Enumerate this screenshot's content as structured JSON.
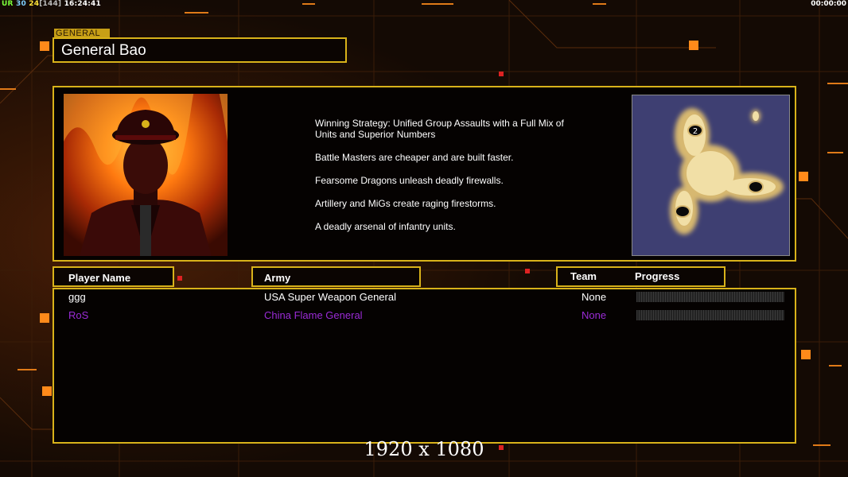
{
  "hud": {
    "label_a": "UR",
    "fps_a": "30",
    "fps_b": "24",
    "bracket": "[144]",
    "clock": "16:24:41",
    "timer": "00:00:00"
  },
  "general": {
    "tag": "GENERAL",
    "name": "General Bao"
  },
  "strategy": [
    "Winning Strategy: Unified Group Assaults with a Full Mix of Units and Superior Numbers",
    "Battle Masters are cheaper and are built faster.",
    "Fearsome Dragons unleash deadly firewalls.",
    "Artillery and MiGs create raging firestorms.",
    "A deadly arsenal of infantry units."
  ],
  "minimap": {
    "start_marker": "2"
  },
  "columns": {
    "player_name": "Player Name",
    "army": "Army",
    "team": "Team",
    "progress": "Progress"
  },
  "players": [
    {
      "name": "ggg",
      "army": "USA Super Weapon General",
      "team": "None",
      "color": "#ffffff",
      "progress": 0
    },
    {
      "name": "RoS",
      "army": "China Flame General",
      "team": "None",
      "color": "#9a2bd6",
      "progress": 0
    }
  ],
  "resolution": "1920 x 1080",
  "colors": {
    "frame": "#d8b21a",
    "accent_orange": "#ff8a1a",
    "hud_green": "#7cff3a",
    "hud_cyan": "#7fd0ff",
    "hud_yellow": "#ffe43a"
  }
}
